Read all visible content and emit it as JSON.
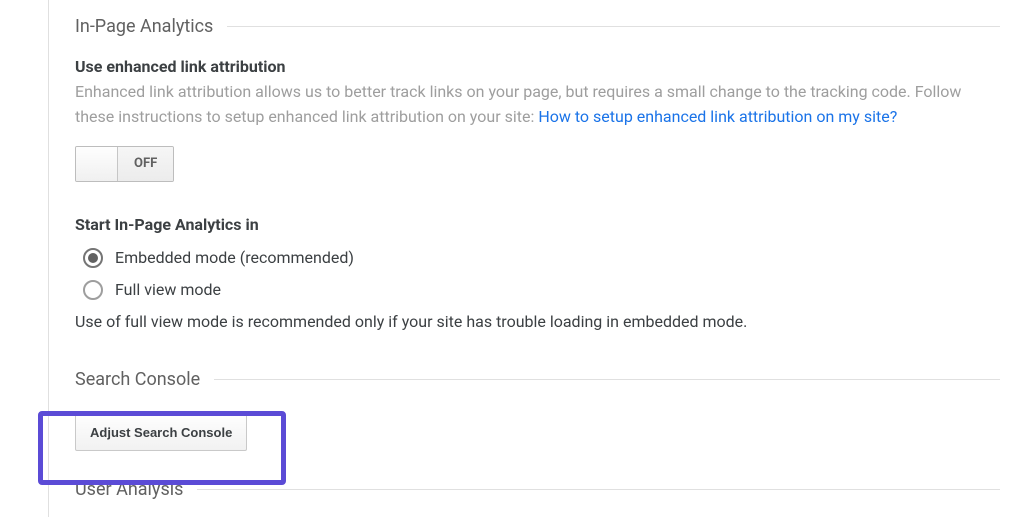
{
  "sections": {
    "inPageAnalytics": {
      "title": "In-Page Analytics",
      "enhancedLink": {
        "title": "Use enhanced link attribution",
        "descPrefix": "Enhanced link attribution allows us to better track links on your page, but requires a small change to the tracking code. Follow these instructions to setup enhanced link attribution on your site: ",
        "linkText": "How to setup enhanced link attribution on my site?",
        "toggleState": "OFF"
      },
      "startMode": {
        "title": "Start In-Page Analytics in",
        "options": {
          "embedded": "Embedded mode (recommended)",
          "fullview": "Full view mode"
        },
        "selected": "embedded",
        "hint": "Use of full view mode is recommended only if your site has trouble loading in embedded mode."
      }
    },
    "searchConsole": {
      "title": "Search Console",
      "buttonLabel": "Adjust Search Console"
    },
    "userAnalysis": {
      "title": "User Analysis"
    }
  }
}
